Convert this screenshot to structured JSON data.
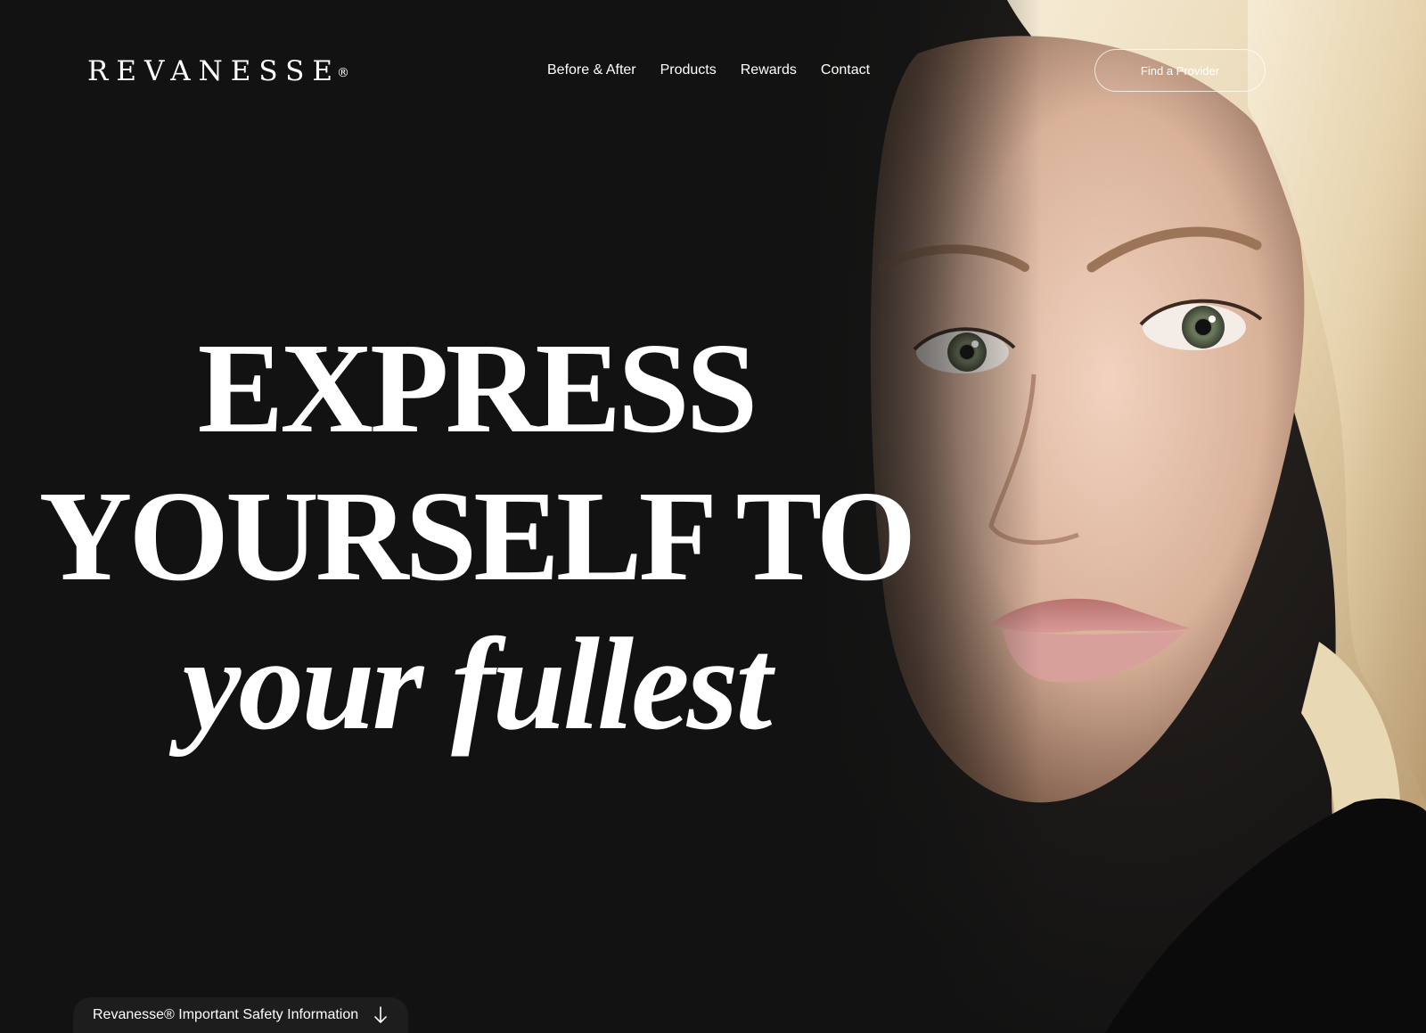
{
  "brand": {
    "logo_text": "REVANESSE",
    "registered_mark": "®"
  },
  "nav": {
    "items": [
      {
        "label": "Before & After"
      },
      {
        "label": "Products"
      },
      {
        "label": "Rewards"
      },
      {
        "label": "Contact"
      }
    ],
    "cta_label": "Find a Provider"
  },
  "hero": {
    "headline_line1": "EXPRESS",
    "headline_line2": "YOURSELF TO",
    "headline_line3": "your fullest"
  },
  "safety_bar": {
    "label": "Revanesse® Important Safety Information",
    "icon": "arrow-down-icon"
  },
  "colors": {
    "background": "#111111",
    "text": "#ffffff",
    "skin": "#e8c7b0",
    "hair": "#efe2c6",
    "lips": "#c98484"
  }
}
